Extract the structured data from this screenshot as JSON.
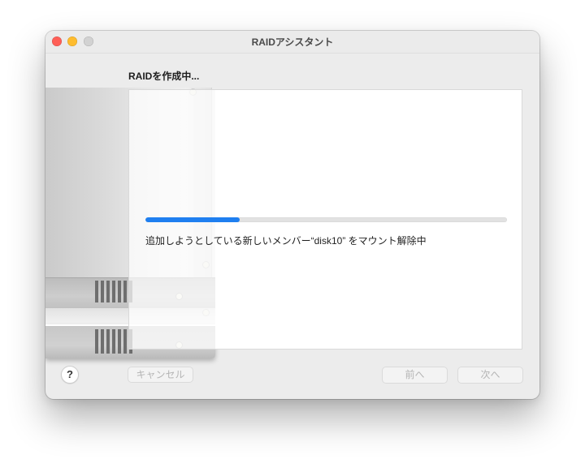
{
  "window": {
    "title": "RAIDアシスタント",
    "traffic_lights": {
      "close_color": "#ff5f57",
      "minimize_color": "#febc2e",
      "zoom_color": "#d2d2d2"
    }
  },
  "main": {
    "heading": "RAIDを作成中...",
    "illustration_icon": "raid-drive-tower-illustration",
    "progress": {
      "fraction": 0.26,
      "fill_color": "#1f7ff0",
      "status_text": "追加しようとしている新しいメンバー“disk10” をマウント解除中"
    }
  },
  "footer": {
    "help_label": "?",
    "cancel_label": "キャンセル",
    "back_label": "前へ",
    "next_label": "次へ"
  }
}
